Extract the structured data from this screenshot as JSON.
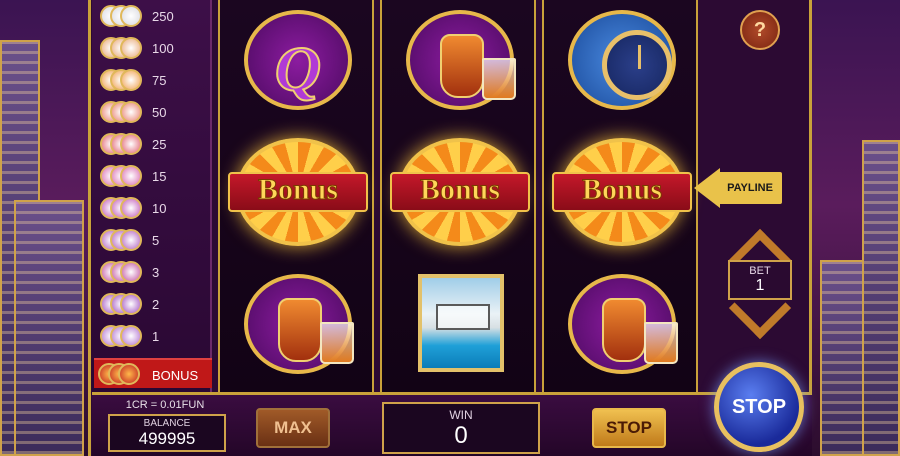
{
  "paytable": {
    "rows": [
      {
        "value": "250",
        "icon": "bar-symbol-icon"
      },
      {
        "value": "100",
        "icon": "cash-symbol-icon"
      },
      {
        "value": "75",
        "icon": "watch-symbol-icon"
      },
      {
        "value": "50",
        "icon": "cognac-symbol-icon"
      },
      {
        "value": "25",
        "icon": "ring-symbol-icon"
      },
      {
        "value": "15",
        "icon": "perfume-symbol-icon"
      },
      {
        "value": "10",
        "icon": "villa-symbol-icon"
      },
      {
        "value": "5",
        "icon": "a-symbol-icon"
      },
      {
        "value": "3",
        "icon": "k-symbol-icon"
      },
      {
        "value": "2",
        "icon": "q-symbol-icon"
      },
      {
        "value": "1",
        "icon": "j-symbol-icon"
      }
    ],
    "bonus_label": "BONUS",
    "bonus_icon_text": "Bonus"
  },
  "reels": {
    "bonus_text": "Bonus",
    "q_letter": "Q",
    "colors": {
      "gold": "#e7b84a",
      "purple": "#8c1ca0",
      "ribbon_red": "#c4182a"
    }
  },
  "payline": {
    "label": "PAYLINE"
  },
  "help": {
    "label": "?"
  },
  "bet": {
    "label": "BET",
    "value": "1"
  },
  "footer": {
    "cr_rate": "1CR = 0.01FUN",
    "balance_label": "BALANCE",
    "balance_value": "499995",
    "max_label": "MAX",
    "win_label": "WIN",
    "win_value": "0",
    "stop_label": "STOP",
    "big_stop_label": "STOP"
  }
}
